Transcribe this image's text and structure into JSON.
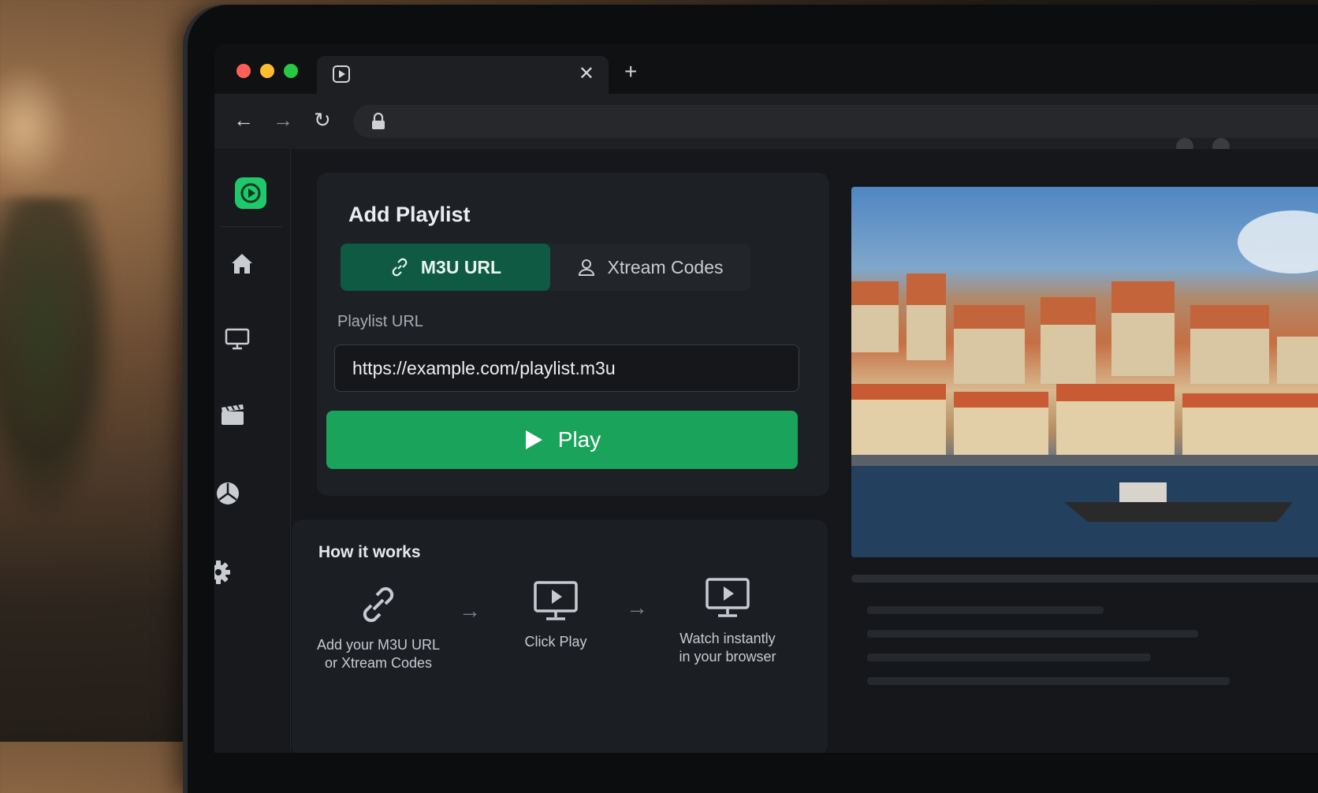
{
  "browser": {
    "tab": {
      "icon": "play-icon"
    },
    "toolbar": {
      "back_icon": "back-arrow-icon",
      "forward_icon": "forward-arrow-icon",
      "reload_icon": "reload-icon",
      "lock_icon": "lock-icon"
    }
  },
  "sidebar": {
    "logo_icon": "play-logo-icon",
    "items": [
      {
        "name": "home",
        "icon": "home-icon"
      },
      {
        "name": "tv",
        "icon": "monitor-icon"
      },
      {
        "name": "movies",
        "icon": "clapperboard-icon"
      },
      {
        "name": "sports",
        "icon": "ball-icon"
      },
      {
        "name": "settings",
        "icon": "gear-icon"
      }
    ]
  },
  "add_playlist": {
    "title": "Add Playlist",
    "tabs": [
      {
        "label": "M3U URL",
        "icon": "link-icon",
        "active": true
      },
      {
        "label": "Xtream Codes",
        "icon": "user-icon",
        "active": false
      }
    ],
    "field_label": "Playlist URL",
    "url_value": "https://example.com/playlist.m3u",
    "play_label": "Play"
  },
  "how_it_works": {
    "title": "How it works",
    "steps": [
      {
        "icon": "link-icon",
        "line1": "Add your M3U URL",
        "line2": "or Xtream Codes"
      },
      {
        "icon": "monitor-play-icon",
        "line1": "Click Play",
        "line2": ""
      },
      {
        "icon": "monitor-play-icon",
        "line1": "Watch instantly",
        "line2": "in your browser"
      }
    ]
  },
  "colors": {
    "accent": "#1aa35a",
    "active_tab": "#0f5a43",
    "logo": "#1ec86b",
    "background": "#15171a"
  }
}
